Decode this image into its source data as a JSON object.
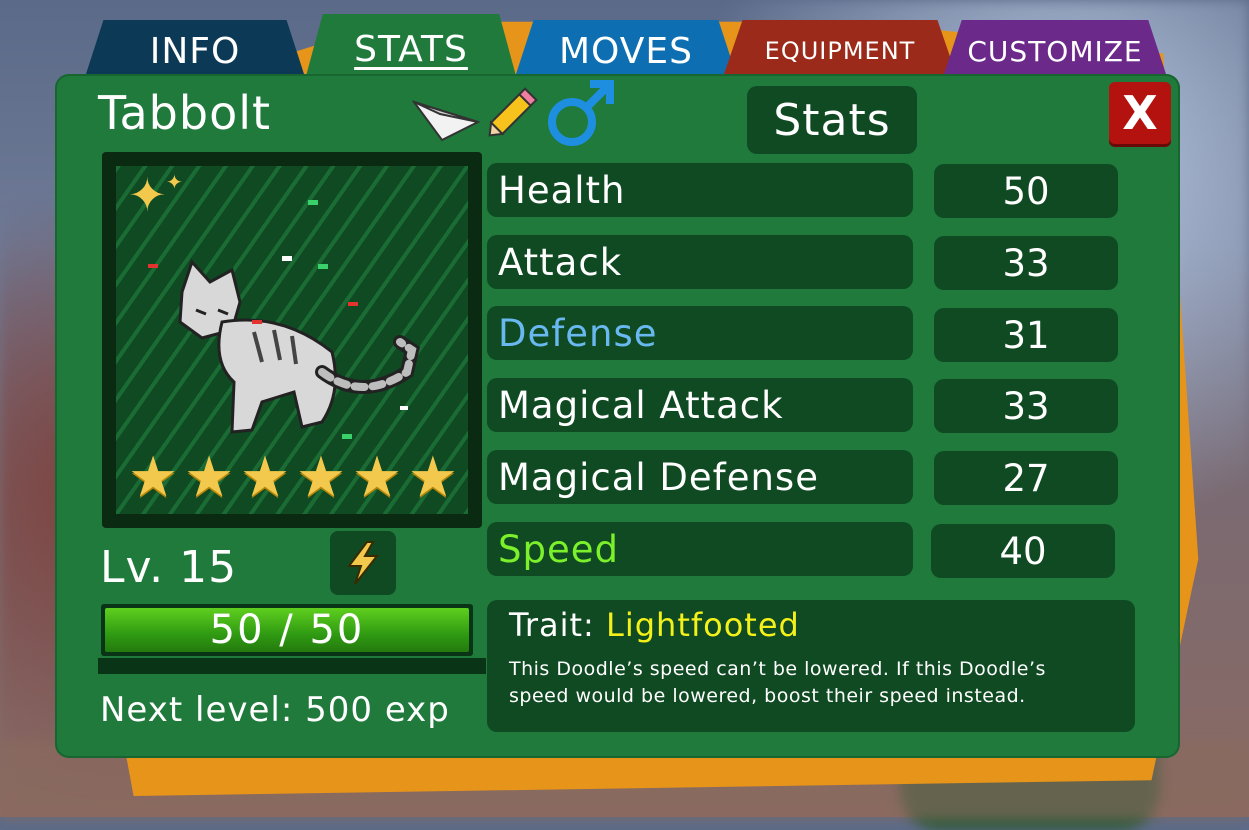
{
  "tabs": [
    {
      "label": "INFO",
      "color": "#0c3a56"
    },
    {
      "label": "STATS",
      "color": "#1f7a3c",
      "active": true
    },
    {
      "label": "MOVES",
      "color": "#0d6fb1"
    },
    {
      "label": "EQUIPMENT",
      "color": "#9c2a1b"
    },
    {
      "label": "CUSTOMIZE",
      "color": "#6b2a8a"
    }
  ],
  "doodle": {
    "name": "Tabbolt",
    "level": "Lv. 15",
    "stars": 6,
    "hp_text": "50 / 50",
    "hp_fraction": 1.0,
    "next_level": "Next level: 500 exp",
    "icons": [
      "paper-plane-icon",
      "pencil-icon",
      "male-symbol-icon",
      "lightning-icon",
      "sparkle-icon"
    ]
  },
  "stats_header": "Stats",
  "close_label": "X",
  "stats": [
    {
      "label": "Health",
      "value": "50",
      "color": "#ffffff"
    },
    {
      "label": "Attack",
      "value": "33",
      "color": "#ffffff"
    },
    {
      "label": "Defense",
      "value": "31",
      "color": "#6ab8f0"
    },
    {
      "label": "Magical Attack",
      "value": "33",
      "color": "#ffffff"
    },
    {
      "label": "Magical Defense",
      "value": "27",
      "color": "#ffffff"
    },
    {
      "label": "Speed",
      "value": "40",
      "color": "#7cf02a"
    }
  ],
  "trait": {
    "prefix": "Trait:",
    "name": "Lightfooted",
    "name_color": "#f4f01a",
    "description": "This Doodle’s speed can’t be lowered. If this Doodle’s speed would be lowered, boost their speed instead."
  }
}
